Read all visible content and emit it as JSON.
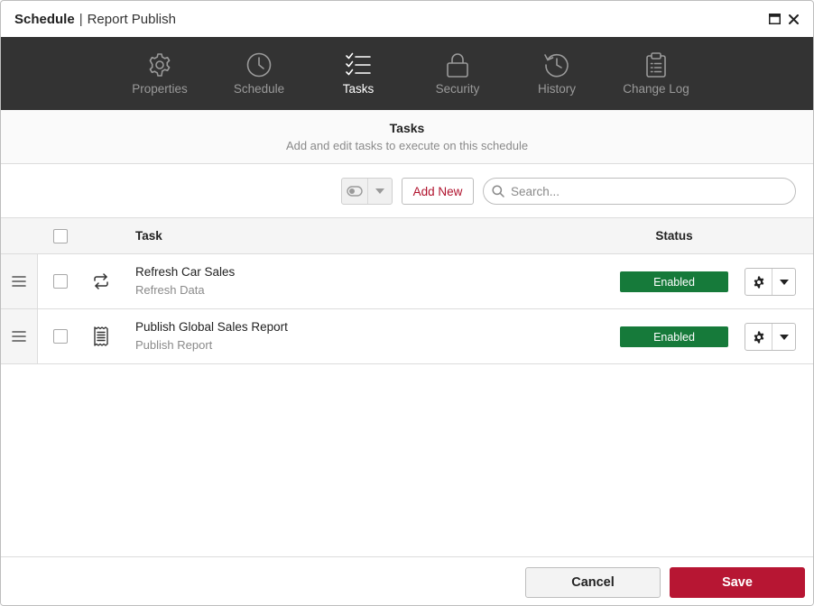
{
  "window": {
    "title": "Schedule",
    "separator": "|",
    "subtitle": "Report Publish",
    "maximize_icon": "window-maximize-icon",
    "close_icon": "close-icon"
  },
  "nav": {
    "tabs": [
      {
        "label": "Properties",
        "icon": "gear-icon",
        "active": false
      },
      {
        "label": "Schedule",
        "icon": "clock-icon",
        "active": false
      },
      {
        "label": "Tasks",
        "icon": "checklist-icon",
        "active": true
      },
      {
        "label": "Security",
        "icon": "lock-icon",
        "active": false
      },
      {
        "label": "History",
        "icon": "history-icon",
        "active": false
      },
      {
        "label": "Change Log",
        "icon": "clipboard-icon",
        "active": false
      }
    ]
  },
  "section": {
    "title": "Tasks",
    "subtitle": "Add and edit tasks to execute on this schedule"
  },
  "toolbar": {
    "add_new_label": "Add New",
    "search_placeholder": "Search..."
  },
  "table": {
    "columns": {
      "task": "Task",
      "status": "Status"
    },
    "rows": [
      {
        "name": "Refresh Car Sales",
        "type": "Refresh Data",
        "icon": "refresh-icon",
        "status": "Enabled"
      },
      {
        "name": "Publish Global Sales Report",
        "type": "Publish Report",
        "icon": "report-icon",
        "status": "Enabled"
      }
    ]
  },
  "footer": {
    "cancel_label": "Cancel",
    "save_label": "Save"
  },
  "colors": {
    "nav_background": "#333333",
    "status_enabled": "#167a3a",
    "primary": "#b71633",
    "accent_text": "#b0122d"
  }
}
